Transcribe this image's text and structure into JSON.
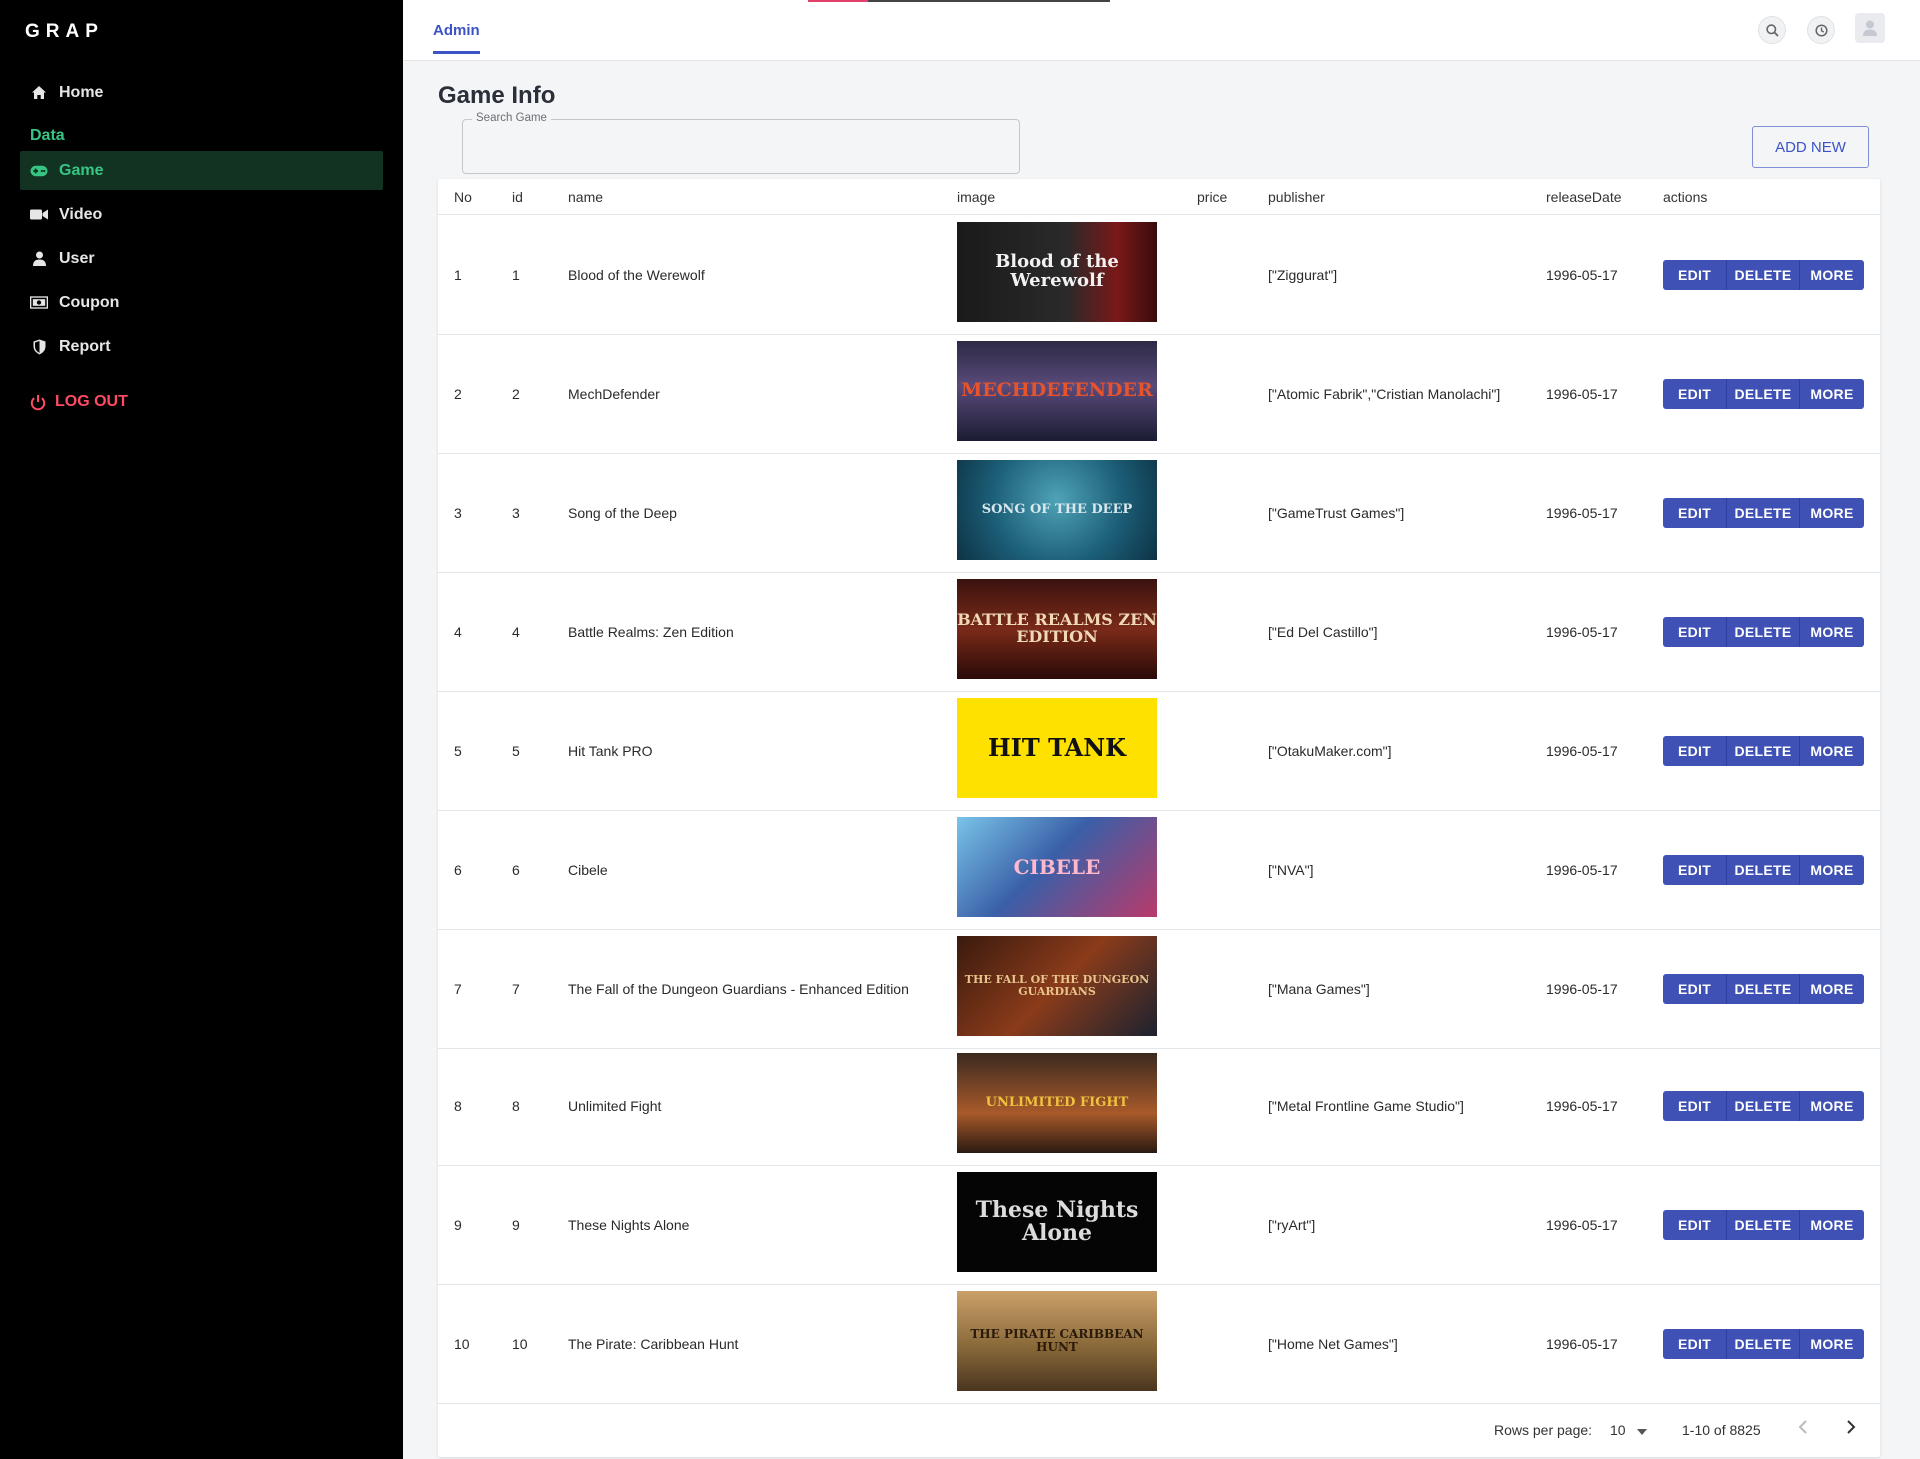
{
  "app": {
    "brand": "GRAP"
  },
  "sidebar": {
    "home_label": "Home",
    "section_label": "Data",
    "items": [
      {
        "label": "Game",
        "icon": "gamepad-icon"
      },
      {
        "label": "Video",
        "icon": "video-camera-icon"
      },
      {
        "label": "User",
        "icon": "user-icon"
      },
      {
        "label": "Coupon",
        "icon": "money-icon"
      },
      {
        "label": "Report",
        "icon": "shield-icon"
      }
    ],
    "logout_label": "LOG OUT"
  },
  "topbar": {
    "tab_label": "Admin"
  },
  "main": {
    "title": "Game Info",
    "search": {
      "label": "Search Game",
      "value": ""
    },
    "add_new_label": "ADD NEW"
  },
  "table": {
    "headers": [
      "No",
      "id",
      "name",
      "image",
      "price",
      "publisher",
      "releaseDate",
      "actions"
    ],
    "action_labels": {
      "edit": "EDIT",
      "delete": "DELETE",
      "more": "MORE"
    },
    "rows": [
      {
        "no": "1",
        "id": "1",
        "name": "Blood of the Werewolf",
        "price": "",
        "publisher": "[\"Ziggurat\"]",
        "release_date": "1996-05-17",
        "image_text": "Blood of the Werewolf"
      },
      {
        "no": "2",
        "id": "2",
        "name": "MechDefender",
        "price": "",
        "publisher": "[\"Atomic Fabrik\",\"Cristian Manolachi\"]",
        "release_date": "1996-05-17",
        "image_text": "MECHDEFENDER"
      },
      {
        "no": "3",
        "id": "3",
        "name": "Song of the Deep",
        "price": "",
        "publisher": "[\"GameTrust Games\"]",
        "release_date": "1996-05-17",
        "image_text": "SONG OF THE DEEP"
      },
      {
        "no": "4",
        "id": "4",
        "name": "Battle Realms: Zen Edition",
        "price": "",
        "publisher": "[\"Ed Del Castillo\"]",
        "release_date": "1996-05-17",
        "image_text": "BATTLE REALMS ZEN EDITION"
      },
      {
        "no": "5",
        "id": "5",
        "name": "Hit Tank PRO",
        "price": "",
        "publisher": "[\"OtakuMaker.com\"]",
        "release_date": "1996-05-17",
        "image_text": "HIT TANK"
      },
      {
        "no": "6",
        "id": "6",
        "name": "Cibele",
        "price": "",
        "publisher": "[\"NVA\"]",
        "release_date": "1996-05-17",
        "image_text": "CIBELE"
      },
      {
        "no": "7",
        "id": "7",
        "name": "The Fall of the Dungeon Guardians - Enhanced Edition",
        "price": "",
        "publisher": "[\"Mana Games\"]",
        "release_date": "1996-05-17",
        "image_text": "THE FALL OF THE DUNGEON GUARDIANS"
      },
      {
        "no": "8",
        "id": "8",
        "name": "Unlimited Fight",
        "price": "",
        "publisher": "[\"Metal Frontline Game Studio\"]",
        "release_date": "1996-05-17",
        "image_text": "UNLIMITED FIGHT"
      },
      {
        "no": "9",
        "id": "9",
        "name": "These Nights Alone",
        "price": "",
        "publisher": "[\"ryArt\"]",
        "release_date": "1996-05-17",
        "image_text": "These Nights Alone"
      },
      {
        "no": "10",
        "id": "10",
        "name": "The Pirate: Caribbean Hunt",
        "price": "",
        "publisher": "[\"Home Net Games\"]",
        "release_date": "1996-05-17",
        "image_text": "THE PIRATE CARIBBEAN HUNT"
      }
    ]
  },
  "pagination": {
    "rows_per_page_label": "Rows per page:",
    "rows_per_page": "10",
    "range": "1-10 of 8825"
  },
  "colors": {
    "sidebar_bg": "#000000",
    "accent_green": "#37c584",
    "logout_red": "#ff4a63",
    "primary": "#3f51b5"
  }
}
